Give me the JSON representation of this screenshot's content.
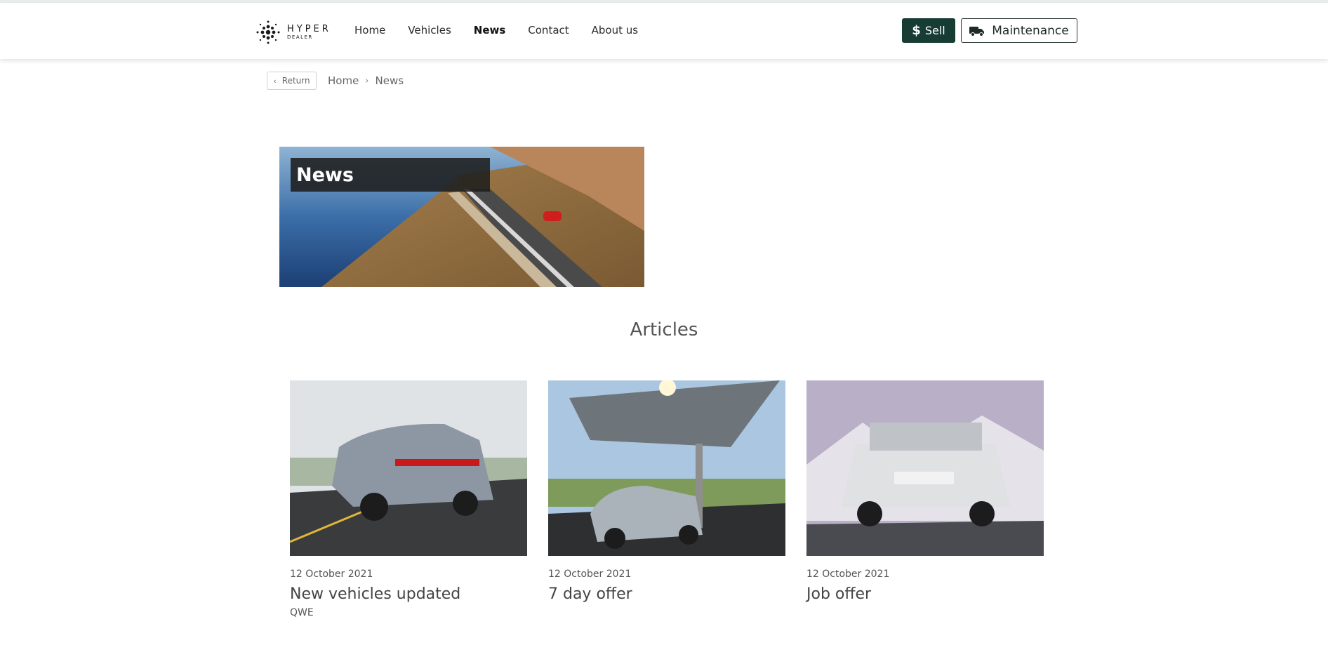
{
  "brand": {
    "line1": "HYPER",
    "line2": "DEALER"
  },
  "nav": [
    {
      "label": "Home",
      "active": false
    },
    {
      "label": "Vehicles",
      "active": false
    },
    {
      "label": "News",
      "active": true
    },
    {
      "label": "Contact",
      "active": false
    },
    {
      "label": "About us",
      "active": false
    }
  ],
  "actions": {
    "sell_label": "Sell",
    "maintenance_label": "Maintenance"
  },
  "breadcrumb": {
    "return_label": "Return",
    "items": [
      "Home",
      "News"
    ]
  },
  "hero": {
    "title": "News"
  },
  "articles_heading": "Articles",
  "articles": [
    {
      "date": "12 October 2021",
      "title": "New vehicles updated",
      "subtitle": "QWE"
    },
    {
      "date": "12 October 2021",
      "title": "7 day offer",
      "subtitle": ""
    },
    {
      "date": "12 October 2021",
      "title": "Job offer",
      "subtitle": ""
    }
  ],
  "colors": {
    "accent": "#173c34",
    "text": "#2b2b2b"
  },
  "icons": [
    "logo-icon",
    "dollar-icon",
    "truck-icon",
    "chevron-left-icon",
    "chevron-right-icon"
  ]
}
